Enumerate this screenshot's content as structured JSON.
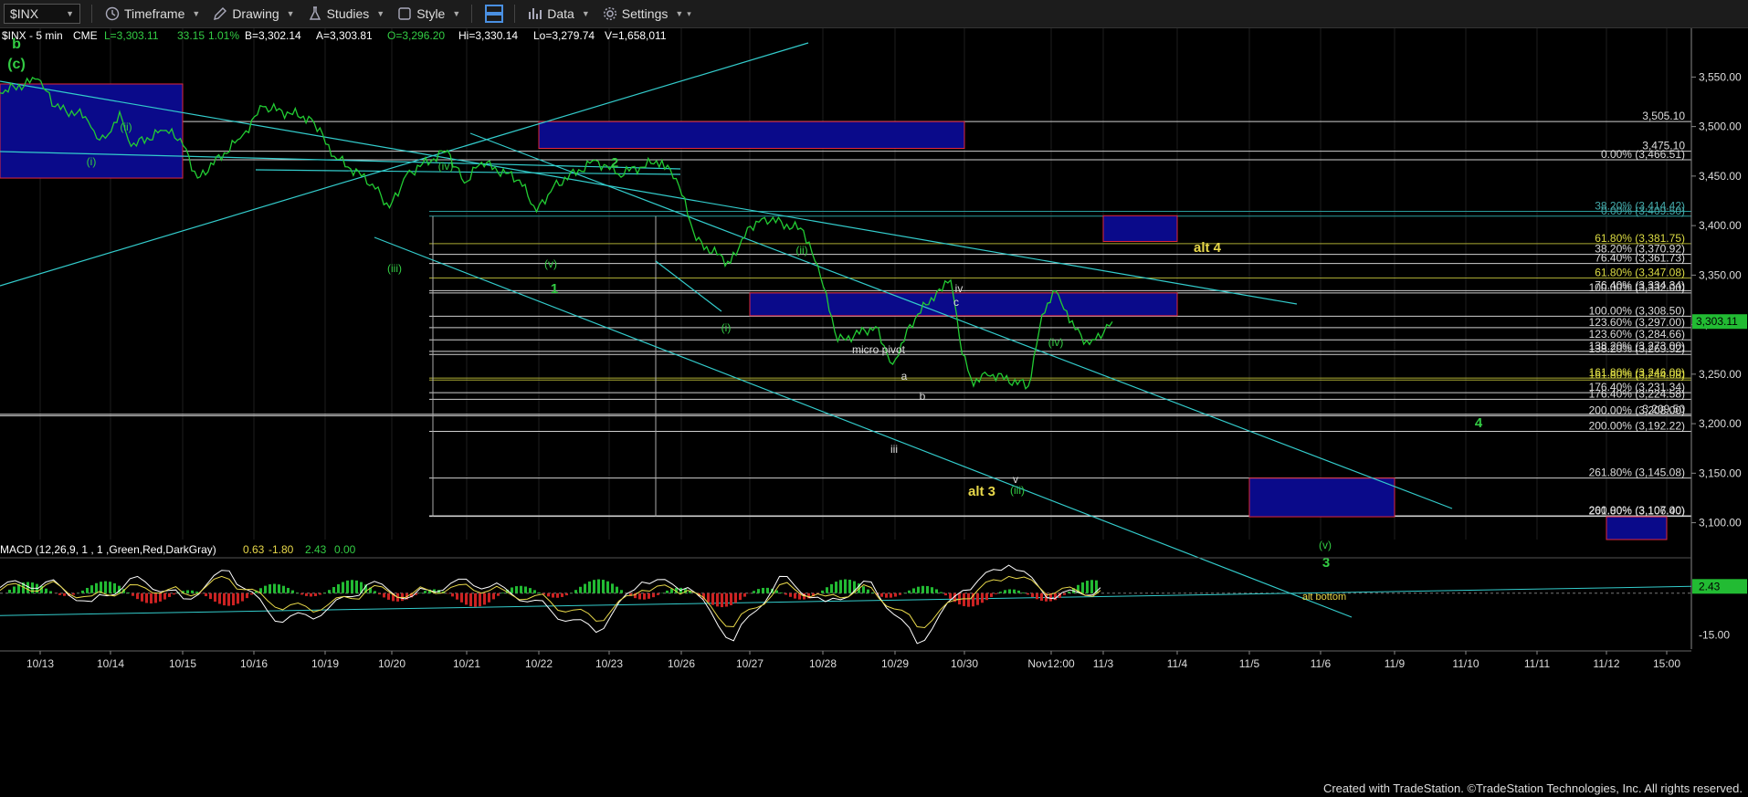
{
  "toolbar": {
    "symbol": "$INX",
    "timeframe": "Timeframe",
    "drawing": "Drawing",
    "studies": "Studies",
    "style": "Style",
    "data": "Data",
    "settings": "Settings"
  },
  "header_text": {
    "symbol_interval": "$INX - 5 min",
    "exchange": "CME",
    "last": "L=3,303.11",
    "change": "33.15",
    "change_pct": "1.01%",
    "bid": "B=3,302.14",
    "ask": "A=3,303.81",
    "open": "O=3,296.20",
    "high": "Hi=3,330.14",
    "low": "Lo=3,279.74",
    "volume": "V=1,658,011"
  },
  "macd_legend": {
    "name": "MACD (12,26,9, 1 , 1 ,Green,Red,DarkGray)",
    "v1": "0.63",
    "v2": "-1.80",
    "v3": "2.43",
    "v4": "0.00"
  },
  "footer": "Created with TradeStation. ©TradeStation Technologies, Inc. All rights reserved.",
  "chart_data": [
    {
      "type": "line",
      "title": "$INX - 5 min",
      "x_ticks": [
        "10/13",
        "10/14",
        "10/15",
        "10/16",
        "10/19",
        "10/20",
        "10/21",
        "10/22",
        "10/23",
        "10/26",
        "10/27",
        "10/28",
        "10/29",
        "10/30",
        "Nov12:00",
        "11/3",
        "11/4",
        "11/5",
        "11/6",
        "11/9",
        "11/10",
        "11/11",
        "11/12",
        "15:00"
      ],
      "y_ticks": [
        3550,
        3500,
        3450,
        3400,
        3350,
        3300,
        3250,
        3200,
        3150,
        3100
      ],
      "y_tick_labels": [
        "3,550.00",
        "3,500.00",
        "3,450.00",
        "3,400.00",
        "3,350.00",
        "3,300.00",
        "3,250.00",
        "3,200.00",
        "3,150.00",
        "3,100.00"
      ],
      "ylim": [
        3083,
        3590
      ],
      "last_price": 3303.11,
      "last_price_label": "3,303.11",
      "colors": {
        "price": "#22cc33",
        "trendline": "#33cccc",
        "zone_fill": "#0a0a8a",
        "zone_border": "#e0283c",
        "level": "#dddddd",
        "level_yellow": "#aaaa33",
        "wave_green": "#33cc44",
        "wave_yellow": "#e8d84a"
      },
      "price_series": [
        [
          "10/13",
          3534
        ],
        [
          "10/13",
          3548
        ],
        [
          "10/13",
          3520
        ],
        [
          "10/14",
          3510
        ],
        [
          "10/14",
          3488
        ],
        [
          "10/14",
          3492
        ],
        [
          "10/14",
          3515
        ],
        [
          "10/14",
          3480
        ],
        [
          "10/15",
          3496
        ],
        [
          "10/15",
          3488
        ],
        [
          "10/15",
          3448
        ],
        [
          "10/16",
          3488
        ],
        [
          "10/16",
          3520
        ],
        [
          "10/19",
          3508
        ],
        [
          "10/19",
          3470
        ],
        [
          "10/20",
          3442
        ],
        [
          "10/20",
          3418
        ],
        [
          "10/20",
          3452
        ],
        [
          "10/21",
          3476
        ],
        [
          "10/21",
          3443
        ],
        [
          "10/21",
          3464
        ],
        [
          "10/22",
          3446
        ],
        [
          "10/22",
          3414
        ],
        [
          "10/22",
          3440
        ],
        [
          "10/23",
          3466
        ],
        [
          "10/23",
          3452
        ],
        [
          "10/26",
          3466
        ],
        [
          "10/26",
          3440
        ],
        [
          "10/26",
          3385
        ],
        [
          "10/27",
          3362
        ],
        [
          "10/27",
          3398
        ],
        [
          "10/27",
          3408
        ],
        [
          "10/28",
          3395
        ],
        [
          "10/28",
          3348
        ],
        [
          "10/28",
          3283
        ],
        [
          "10/29",
          3298
        ],
        [
          "10/29",
          3260
        ],
        [
          "10/29",
          3300
        ],
        [
          "10/30",
          3336
        ],
        [
          "10/30",
          3345
        ],
        [
          "10/30",
          3270
        ],
        [
          "10/30",
          3238
        ],
        [
          "10/30",
          3252
        ],
        [
          "Nov12:00",
          3238
        ],
        [
          "Nov12:00",
          3310
        ],
        [
          "Nov12:00",
          3334
        ],
        [
          "Nov12:00",
          3302
        ],
        [
          "11/3",
          3280
        ],
        [
          "11/3",
          3303
        ]
      ],
      "horizontal_levels": [
        {
          "value": 3505.1,
          "label": "3,505.10"
        },
        {
          "value": 3475.1,
          "label": "3,475.10"
        },
        {
          "value": 3466.51,
          "label": "0.00% (3,466.51)"
        },
        {
          "value": 3414.42,
          "label": "38.20% (3,414.42)"
        },
        {
          "value": 3409.5,
          "label": "0.00% (3,409.50)"
        },
        {
          "value": 3381.75,
          "label": "61.80% (3,381.75)"
        },
        {
          "value": 3370.92,
          "label": "38.20% (3,370.92)"
        },
        {
          "value": 3361.73,
          "label": "76.40% (3,361.73)"
        },
        {
          "value": 3347.08,
          "label": "61.80% (3,347.08)"
        },
        {
          "value": 3334.34,
          "label": "76.40% (3,334.34)"
        },
        {
          "value": 3332.0,
          "label": "100.00% (3,332.00)"
        },
        {
          "value": 3308.5,
          "label": "100.00% (3,308.50)"
        },
        {
          "value": 3297.0,
          "label": "123.60% (3,297.00)"
        },
        {
          "value": 3284.66,
          "label": "123.60% (3,284.66)"
        },
        {
          "value": 3273.0,
          "label": "138.20% (3,273.00)"
        },
        {
          "value": 3269.92,
          "label": "138.20% (3,269.92)"
        },
        {
          "value": 3246.0,
          "label": "161.80% (3,246.00)"
        },
        {
          "value": 3244.08,
          "label": "161.80% (3,244.08)"
        },
        {
          "value": 3231.34,
          "label": "176.40% (3,231.34)"
        },
        {
          "value": 3224.58,
          "label": "176.40% (3,224.58)"
        },
        {
          "value": 3209.5,
          "label": "3,209.50"
        },
        {
          "value": 3208.0,
          "label": "200.00% (3,208.00)"
        },
        {
          "value": 3192.22,
          "label": "200.00% (3,192.22)"
        },
        {
          "value": 3145.08,
          "label": "261.80% (3,145.08)"
        },
        {
          "value": 3107.0,
          "label": "200.00% (3,107.00)"
        },
        {
          "value": 3106.4,
          "label": "261.80% (3,106.40)"
        }
      ],
      "zones": [
        {
          "x0": "10/12",
          "x1": "10/15",
          "y0": 3448,
          "y1": 3543
        },
        {
          "x0": "10/22",
          "x1": "10/30",
          "y0": 3478,
          "y1": 3505
        },
        {
          "x0": "11/3",
          "x1": "11/4",
          "y0": 3384,
          "y1": 3410
        },
        {
          "x0": "10/27",
          "x1": "11/4",
          "y0": 3309,
          "y1": 3332
        },
        {
          "x0": "11/5",
          "x1": "11/9",
          "y0": 3106,
          "y1": 3145
        },
        {
          "x0": "11/12",
          "x1": "15:00",
          "y0": 3083,
          "y1": 3106
        }
      ],
      "wave_labels": [
        {
          "text": "b",
          "color": "green"
        },
        {
          "text": "(c)",
          "color": "green"
        },
        {
          "text": "(i)",
          "color": "green"
        },
        {
          "text": "(ii)",
          "color": "green"
        },
        {
          "text": "(iii)",
          "color": "green"
        },
        {
          "text": "(iv)",
          "color": "green"
        },
        {
          "text": "(v)",
          "color": "green"
        },
        {
          "text": "1",
          "color": "green"
        },
        {
          "text": "2",
          "color": "green"
        },
        {
          "text": "(i)",
          "color": "green"
        },
        {
          "text": "(ii)",
          "color": "green"
        },
        {
          "text": "micro pivot",
          "color": "white"
        },
        {
          "text": "a",
          "color": "white"
        },
        {
          "text": "b",
          "color": "white"
        },
        {
          "text": "c",
          "color": "white"
        },
        {
          "text": "iii",
          "color": "white"
        },
        {
          "text": "iv",
          "color": "white"
        },
        {
          "text": "v",
          "color": "white"
        },
        {
          "text": "(iv)",
          "color": "green"
        },
        {
          "text": "(iii)",
          "color": "green"
        },
        {
          "text": "alt 3",
          "color": "yellow"
        },
        {
          "text": "alt 4",
          "color": "yellow"
        },
        {
          "text": "(v)",
          "color": "green"
        },
        {
          "text": "3",
          "color": "green"
        },
        {
          "text": "alt bottom",
          "color": "yellow"
        },
        {
          "text": "4",
          "color": "green"
        }
      ]
    },
    {
      "type": "line",
      "title": "MACD (12,26,9, 1 , 1 ,Green,Red,DarkGray)",
      "y_ticks": [
        2.43,
        -15.0
      ],
      "y_tick_labels": [
        "2.43",
        "-15.00"
      ],
      "ylim": [
        -20,
        12
      ],
      "series": [
        {
          "name": "MACD",
          "color": "#ffffff",
          "values": [
            2,
            4,
            -3,
            6,
            -2,
            8,
            -10,
            -8,
            3,
            -1,
            5,
            2,
            -6,
            -14,
            4,
            2,
            -17,
            6,
            -3,
            4,
            -18,
            1,
            10,
            -2,
            2
          ]
        },
        {
          "name": "Signal",
          "color": "#e8d84a",
          "values": [
            1,
            3,
            -1,
            3,
            0,
            5,
            -5,
            -6,
            1,
            0,
            3,
            1,
            -3,
            -10,
            1,
            1,
            -12,
            3,
            -1,
            2,
            -12,
            -2,
            6,
            0,
            1
          ]
        }
      ]
    }
  ]
}
